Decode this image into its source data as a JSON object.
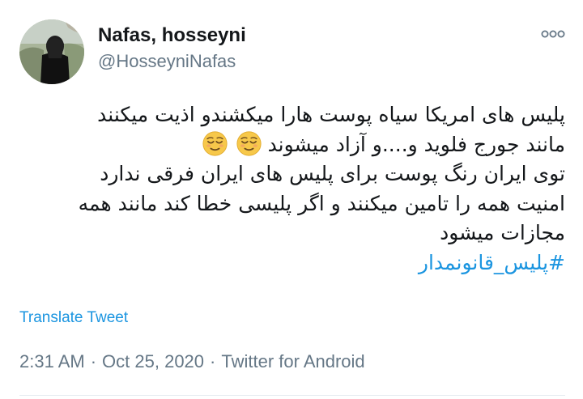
{
  "author": {
    "display_name": "Nafas, hosseyni",
    "handle": "@HosseyniNafas"
  },
  "tweet": {
    "lines": [
      "پلیس های امریکا سیاه پوست هارا میکشندو اذیت میکنند",
      "مانند جورج فلوید و....و آزاد میشوند",
      "توی ایران رنگ پوست برای پلیس های ایران فرقی ندارد",
      "امنیت همه را تامین میکنند و اگر پلیسی خطا کند مانند همه",
      "مجازات میشود"
    ],
    "hashtag": "#پلیس_قانونمدار"
  },
  "actions": {
    "translate_label": "Translate Tweet"
  },
  "meta": {
    "time": "2:31 AM",
    "separator": "·",
    "date": "Oct 25, 2020",
    "source": "Twitter for Android"
  },
  "icons": {
    "more": "more-options-icon",
    "emoji": "relieved-face-emoji"
  },
  "colors": {
    "link": "#1b95e0",
    "secondary_text": "#657786",
    "primary_text": "#14171a"
  }
}
